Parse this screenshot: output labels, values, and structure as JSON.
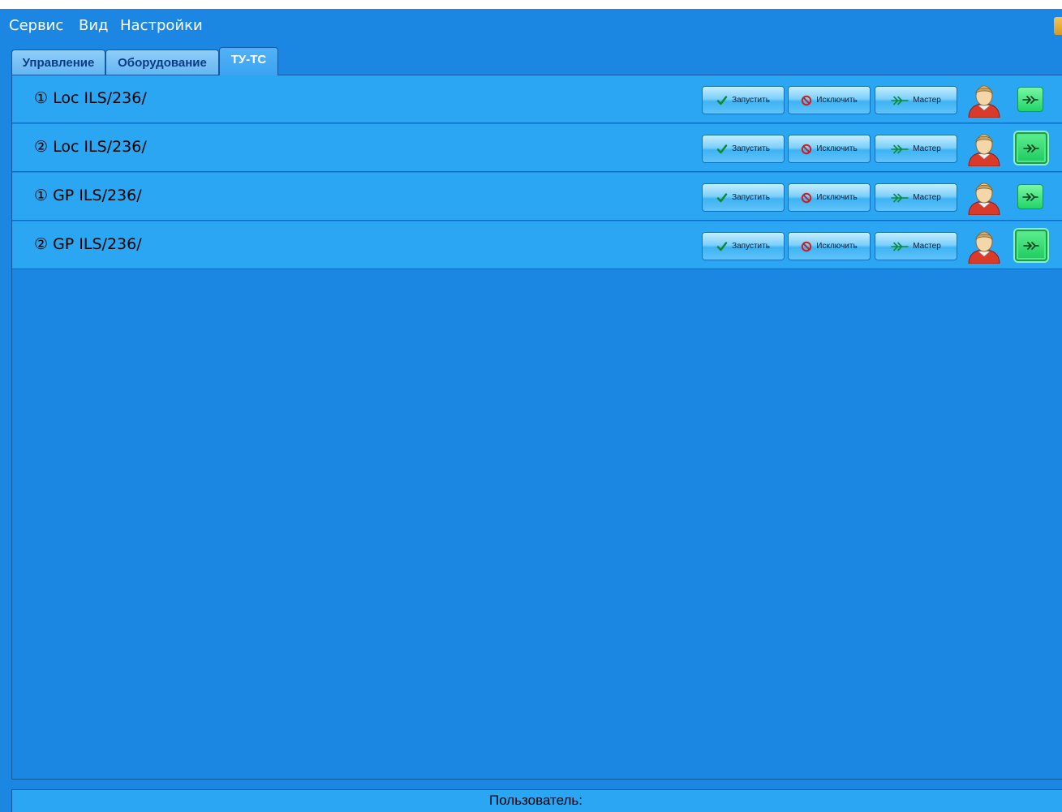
{
  "menu": {
    "service": "Сервис",
    "view": "Вид",
    "settings": "Настройки"
  },
  "tabs": [
    {
      "label": "Управление",
      "active": false
    },
    {
      "label": "Оборудование",
      "active": false
    },
    {
      "label": "ТУ-ТС",
      "active": true
    }
  ],
  "rows": [
    {
      "title": "① Loc ILS/236/",
      "run_label": "Запустить",
      "exclude_label": "Исключить",
      "master_label": "Мастер",
      "user_icon": "user-red-icon",
      "go_icon": "double-arrow-right-icon",
      "go_highlighted": false
    },
    {
      "title": "② Loc ILS/236/",
      "run_label": "Запустить",
      "exclude_label": "Исключить",
      "master_label": "Мастер",
      "user_icon": "user-red-icon",
      "go_icon": "double-arrow-right-icon",
      "go_highlighted": true
    },
    {
      "title": "① GP ILS/236/",
      "run_label": "Запустить",
      "exclude_label": "Исключить",
      "master_label": "Мастер",
      "user_icon": "user-red-icon",
      "go_icon": "double-arrow-right-icon",
      "go_highlighted": false
    },
    {
      "title": "② GP ILS/236/",
      "run_label": "Запустить",
      "exclude_label": "Исключить",
      "master_label": "Мастер",
      "user_icon": "user-red-icon",
      "go_icon": "double-arrow-right-icon",
      "go_highlighted": true
    }
  ],
  "status": {
    "user_label": "Пользователь:"
  },
  "colors": {
    "background": "#1b87e3",
    "row": "#2ba6f3",
    "go_button": "#21d468",
    "user_body": "#d93a2a"
  }
}
